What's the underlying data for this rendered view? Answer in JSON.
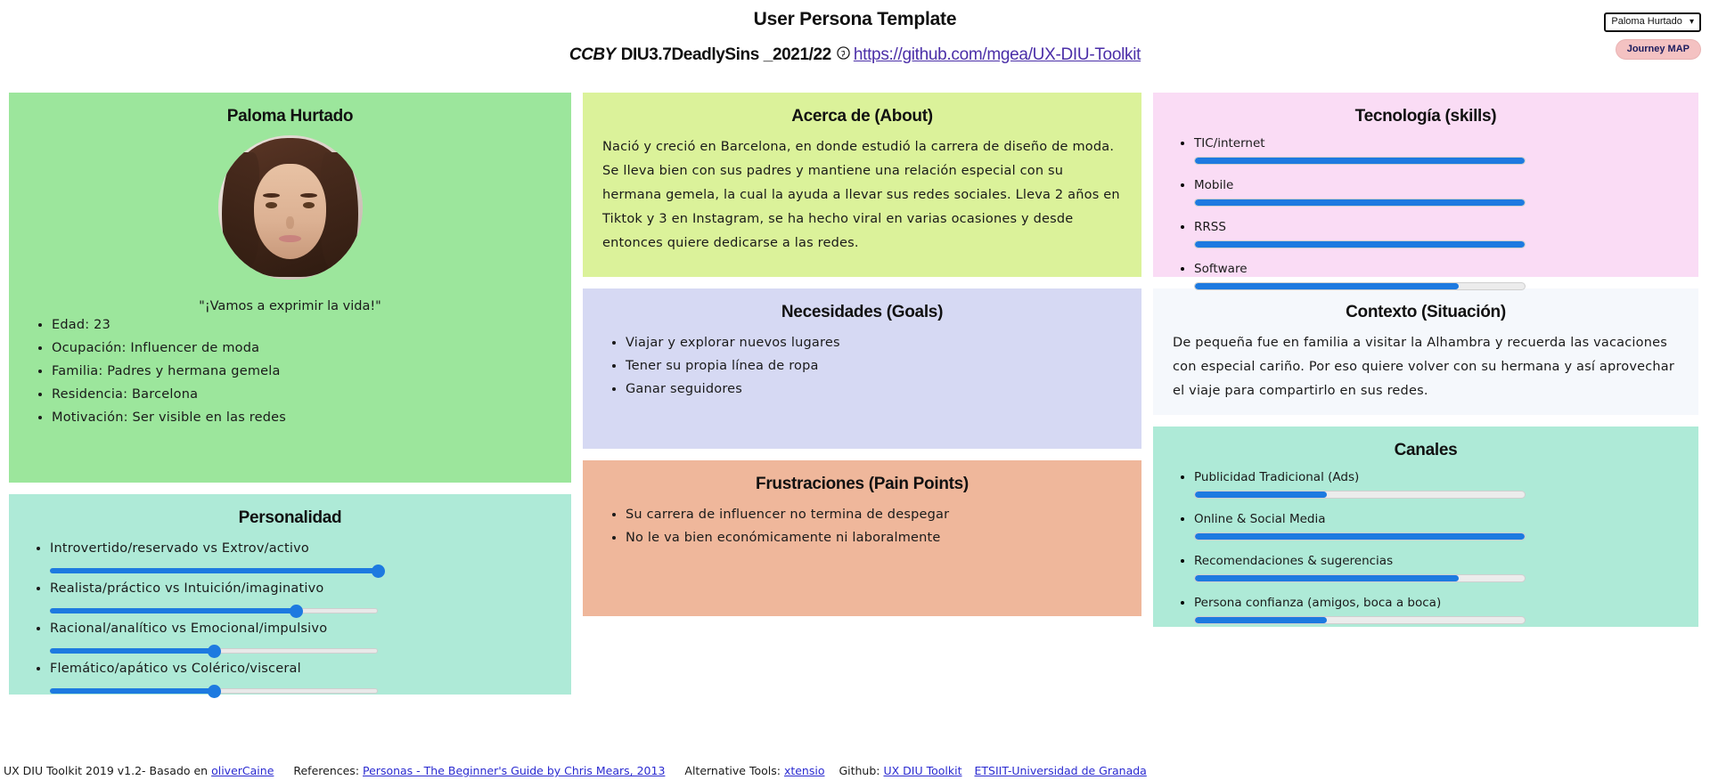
{
  "header": {
    "title": "User Persona Template",
    "license": "CCBY",
    "course": "DIU3.7DeadlySins _2021/22",
    "github_icon": "github-icon",
    "repo_url_text": "https://github.com/mgea/UX-DIU-Toolkit",
    "persona_selector_value": "Paloma Hurtado",
    "persona_selector_caret": "⌄",
    "journey_button": "Journey MAP"
  },
  "persona": {
    "name": "Paloma Hurtado",
    "quote": "\"¡Vamos a exprimir la vida!\"",
    "details": [
      "Edad: 23",
      "Ocupación: Influencer de moda",
      "Familia: Padres y hermana gemela",
      "Residencia: Barcelona",
      "Motivación: Ser visible en las redes"
    ]
  },
  "personality": {
    "title": "Personalidad",
    "traits": [
      {
        "label": "Introvertido/reservado vs Extrov/activo",
        "value": 100
      },
      {
        "label": "Realista/práctico vs Intuición/imaginativo",
        "value": 75
      },
      {
        "label": "Racional/analítico vs Emocional/impulsivo",
        "value": 50
      },
      {
        "label": "Flemático/apático vs Colérico/visceral",
        "value": 50
      }
    ]
  },
  "about": {
    "title": "Acerca de (About)",
    "text": "Nació y creció en Barcelona, en donde estudió la carrera de diseño de moda. Se lleva bien con sus padres y mantiene una relación especial con su hermana gemela, la cual la ayuda a llevar sus redes sociales. Lleva 2 años en Tiktok y 3 en Instagram, se ha hecho viral en varias ocasiones y desde entonces quiere dedicarse a las redes."
  },
  "goals": {
    "title": "Necesidades (Goals)",
    "items": [
      "Viajar y explorar nuevos lugares",
      "Tener su propia línea de ropa",
      "Ganar seguidores"
    ]
  },
  "pain_points": {
    "title": "Frustraciones (Pain Points)",
    "items": [
      "Su carrera de influencer no termina de despegar",
      "No le va bien económicamente ni laboralmente"
    ]
  },
  "skills": {
    "title": "Tecnología (skills)",
    "items": [
      {
        "label": "TIC/internet",
        "value": 100
      },
      {
        "label": "Mobile",
        "value": 100
      },
      {
        "label": "RRSS",
        "value": 100
      },
      {
        "label": "Software",
        "value": 80
      }
    ]
  },
  "context": {
    "title": "Contexto (Situación)",
    "text": "De pequeña fue en familia a visitar la Alhambra y recuerda las vacaciones con especial cariño. Por eso quiere volver con su hermana y así aprovechar el viaje para compartirlo en sus redes."
  },
  "channels": {
    "title": "Canales",
    "items": [
      {
        "label": "Publicidad Tradicional (Ads)",
        "value": 40
      },
      {
        "label": "Online & Social Media",
        "value": 100
      },
      {
        "label": "Recomendaciones & sugerencias",
        "value": 80
      },
      {
        "label": "Persona confianza (amigos, boca a boca)",
        "value": 40
      }
    ]
  },
  "footer": {
    "toolkit": "UX DIU Toolkit 2019 v1.2- Basado en",
    "author_link": "oliverCaine",
    "references_label": "References:",
    "references_link": "Personas - The Beginner's Guide by Chris Mears, 2013",
    "alt_tools_label": "Alternative Tools:",
    "alt_tools_link": "xtensio",
    "github_label": "Github:",
    "github_link1": "UX DIU Toolkit",
    "github_link2": "ETSIIT-Universidad de Granada"
  },
  "colors": {
    "accent_blue": "#1d7ae0",
    "persona_green": "#9ce69c",
    "mint": "#aeead7",
    "lime": "#dbf29a",
    "lavender": "#d6d9f3",
    "peach": "#efb79b",
    "pink": "#fadcf5",
    "journey_pink": "#f4c2c2",
    "link_purple": "#4b2fa8"
  }
}
